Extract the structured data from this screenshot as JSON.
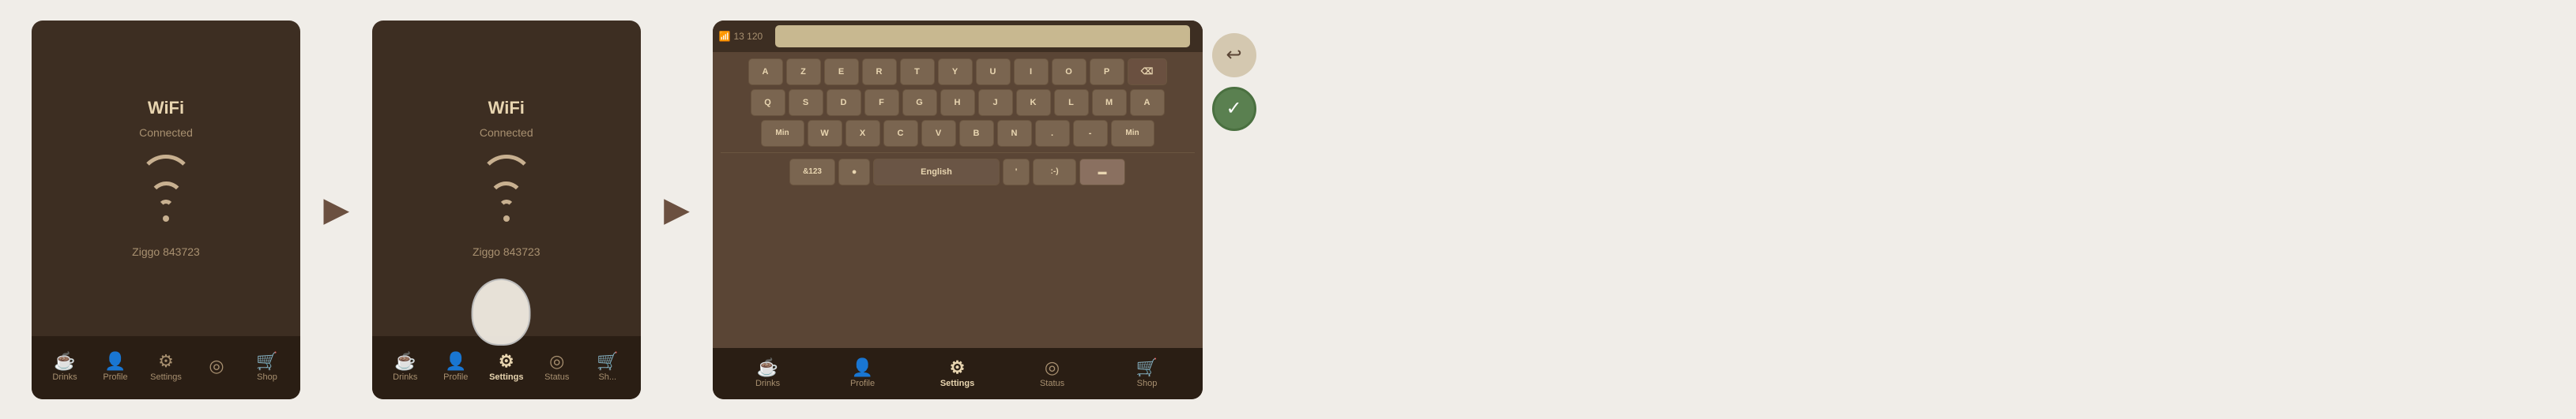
{
  "devices": [
    {
      "id": "device-1",
      "wifi": {
        "title": "WiFi",
        "status": "Connected",
        "network": "Ziggo 843723"
      },
      "nav": [
        {
          "id": "drinks",
          "label": "Drinks",
          "icon": "☕",
          "active": false
        },
        {
          "id": "profile",
          "label": "Profile",
          "icon": "👤",
          "active": false
        },
        {
          "id": "settings",
          "label": "Settings",
          "icon": "⚙",
          "active": false
        },
        {
          "id": "status",
          "label": "",
          "icon": "◎",
          "active": false
        },
        {
          "id": "shop",
          "label": "Shop",
          "icon": "🛒",
          "active": false
        }
      ],
      "hasFingerOverlay": false
    },
    {
      "id": "device-2",
      "wifi": {
        "title": "WiFi",
        "status": "Connected",
        "network": "Ziggo 843723"
      },
      "nav": [
        {
          "id": "drinks",
          "label": "Drinks",
          "icon": "☕",
          "active": false
        },
        {
          "id": "profile",
          "label": "Profile",
          "icon": "👤",
          "active": false
        },
        {
          "id": "settings",
          "label": "Settings",
          "icon": "⚙",
          "active": true
        },
        {
          "id": "status",
          "label": "Status",
          "icon": "◎",
          "active": false
        },
        {
          "id": "shop",
          "label": "Sh...",
          "icon": "🛒",
          "active": false
        }
      ],
      "hasFingerOverlay": true
    }
  ],
  "keyboard_device": {
    "signal": "13 120",
    "nav": [
      {
        "id": "drinks",
        "label": "Drinks",
        "icon": "☕",
        "active": false
      },
      {
        "id": "profile",
        "label": "Profile",
        "icon": "👤",
        "active": false
      },
      {
        "id": "settings",
        "label": "Settings",
        "icon": "⚙",
        "active": true
      },
      {
        "id": "status",
        "label": "Status",
        "icon": "◎",
        "active": false
      },
      {
        "id": "shop",
        "label": "Shop",
        "icon": "🛒",
        "active": false
      }
    ],
    "keyboard": {
      "rows": [
        [
          "A",
          "Z",
          "E",
          "R",
          "T",
          "Y",
          "U",
          "I",
          "O",
          "P",
          "⌫"
        ],
        [
          "Q",
          "S",
          "D",
          "F",
          "G",
          "H",
          "J",
          "K",
          "L",
          "M",
          "A"
        ],
        [
          "Min",
          "W",
          "X",
          "C",
          "V",
          "B",
          "N",
          ".",
          "-",
          "Min"
        ],
        [
          "&123",
          "●",
          "English",
          "'",
          ":-)",
          "▬"
        ]
      ]
    },
    "side_buttons": {
      "back": "↩",
      "check": "✓"
    }
  },
  "arrows": [
    "▶",
    "▶"
  ],
  "colors": {
    "device_bg": "#3d2e22",
    "nav_bg": "#2a1e14",
    "active_nav": "#e8d5b0",
    "inactive_nav": "#a89070",
    "wifi_arc": "#c8b090",
    "key_bg": "#7a6550",
    "key_text": "#e8d5b0",
    "keyboard_bg": "#5a4535"
  }
}
